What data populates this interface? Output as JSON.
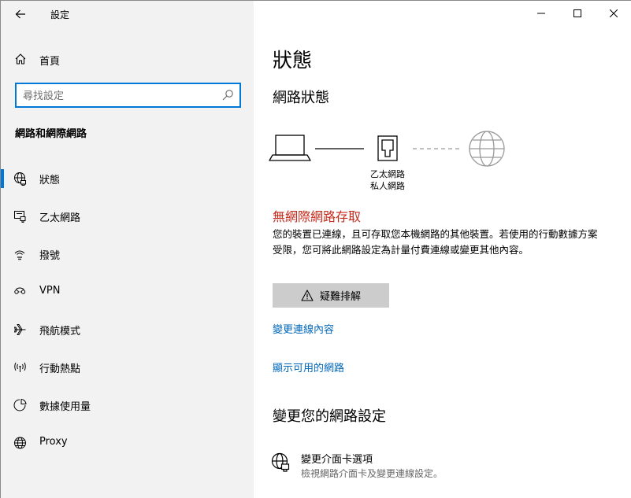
{
  "window": {
    "title": "設定"
  },
  "sidebar": {
    "home_label": "首頁",
    "search_placeholder": "尋找設定",
    "section_heading": "網路和網際網路",
    "items": [
      {
        "label": "狀態",
        "icon": "globe-network-icon",
        "active": true
      },
      {
        "label": "乙太網路",
        "icon": "ethernet-icon",
        "active": false
      },
      {
        "label": "撥號",
        "icon": "dialup-icon",
        "active": false
      },
      {
        "label": "VPN",
        "icon": "vpn-icon",
        "active": false
      },
      {
        "label": "飛航模式",
        "icon": "airplane-icon",
        "active": false
      },
      {
        "label": "行動熱點",
        "icon": "hotspot-icon",
        "active": false
      },
      {
        "label": "數據使用量",
        "icon": "data-usage-icon",
        "active": false
      },
      {
        "label": "Proxy",
        "icon": "globe-icon",
        "active": false
      }
    ]
  },
  "main": {
    "title": "狀態",
    "network_status_heading": "網路狀態",
    "adapter_name": "乙太網路",
    "adapter_type": "私人網路",
    "status_heading": "無網際網路存取",
    "status_description": "您的裝置已連線，且可存取您本機網路的其他裝置。若使用的行動數據方案受限，您可將此網路設定為計量付費連線或變更其他內容。",
    "troubleshoot_label": "疑難排解",
    "link_change_properties": "變更連線內容",
    "link_show_networks": "顯示可用的網路",
    "change_settings_heading": "變更您的網路設定",
    "adapter_options_title": "變更介面卡選項",
    "adapter_options_desc": "檢視網路介面卡及變更連線設定。"
  },
  "colors": {
    "accent": "#0078d7",
    "error": "#c42b1c",
    "link": "#0067b8",
    "sidebar_bg": "#f2f2f2"
  }
}
